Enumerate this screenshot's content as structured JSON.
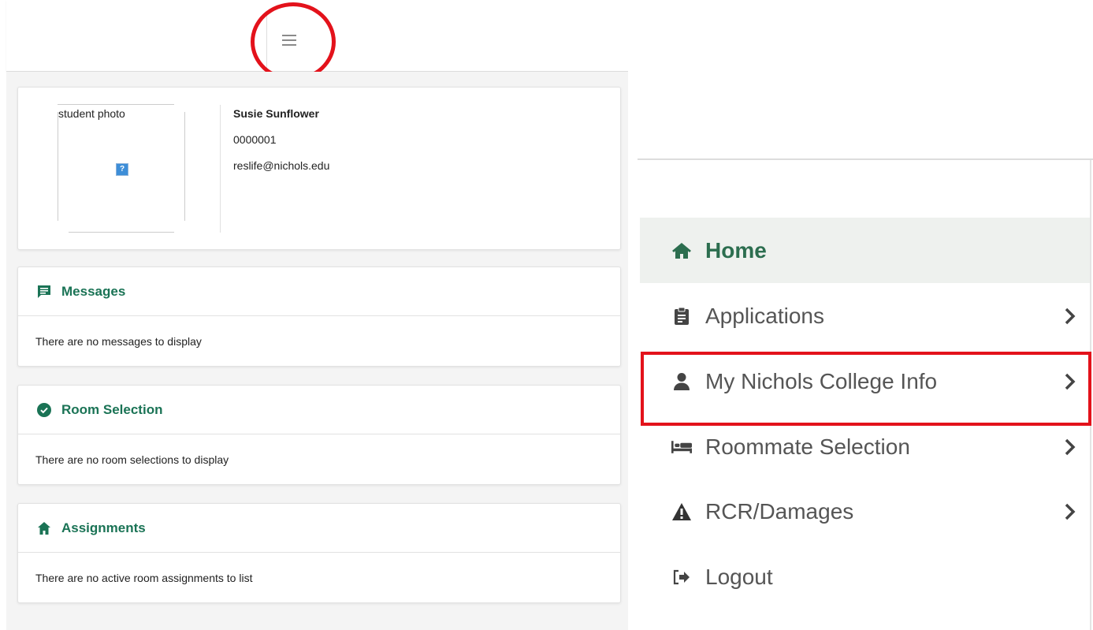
{
  "profile": {
    "photo_alt": "student photo",
    "name": "Susie Sunflower",
    "id": "0000001",
    "email": "reslife@nichols.edu"
  },
  "messages": {
    "title": "Messages",
    "body": "There are no messages to display"
  },
  "room_selection": {
    "title": "Room Selection",
    "body": "There are no room selections to display"
  },
  "assignments": {
    "title": "Assignments",
    "body": "There are no active room assignments to list"
  },
  "nav": {
    "home": "Home",
    "applications": "Applications",
    "my_info": "My Nichols College Info",
    "roommate": "Roommate Selection",
    "rcr": "RCR/Damages",
    "logout": "Logout"
  },
  "colors": {
    "accent_green": "#1a7355",
    "home_green": "#2c6e4f",
    "highlight_red": "#e3121b"
  },
  "icons": {
    "menu": "hamburger-icon",
    "messages": "message-icon",
    "room_selection": "check-circle-icon",
    "assignments": "house-icon",
    "home": "home-icon",
    "applications": "clipboard-icon",
    "my_info": "user-icon",
    "roommate": "bed-icon",
    "rcr": "warning-icon",
    "logout": "sign-out-icon",
    "chevron": "chevron-right-icon"
  }
}
